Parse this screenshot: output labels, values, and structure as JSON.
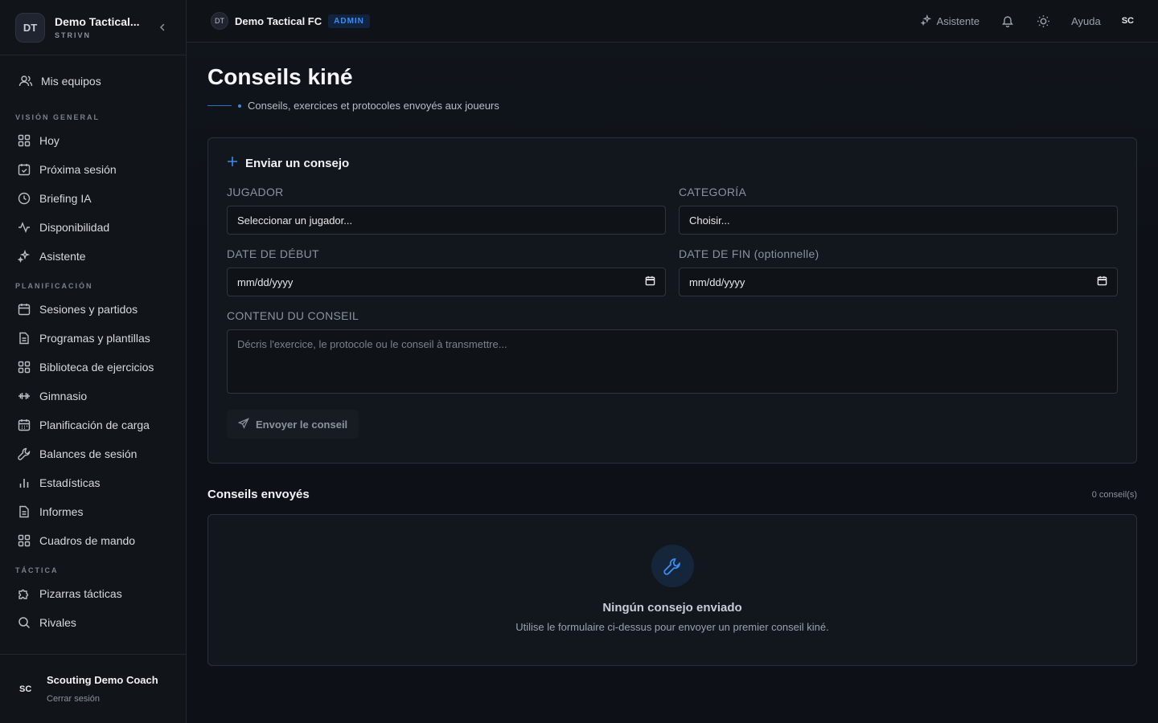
{
  "brand": {
    "initials": "DT",
    "name": "Demo Tactical...",
    "sub": "STRIVN"
  },
  "sidebar": {
    "top_item": "Mis equipos",
    "sections": [
      {
        "title": "VISIÓN GENERAL",
        "items": [
          "Hoy",
          "Próxima sesión",
          "Briefing IA",
          "Disponibilidad",
          "Asistente"
        ]
      },
      {
        "title": "PLANIFICACIÓN",
        "items": [
          "Sesiones y partidos",
          "Programas y plantillas",
          "Biblioteca de ejercicios",
          "Gimnasio",
          "Planificación de carga",
          "Balances de sesión",
          "Estadísticas",
          "Informes",
          "Cuadros de mando"
        ]
      },
      {
        "title": "TÁCTICA",
        "items": [
          "Pizarras tácticas",
          "Rivales"
        ]
      }
    ],
    "user": {
      "initials": "SC",
      "name": "Scouting Demo Coach",
      "logout": "Cerrar sesión"
    }
  },
  "topbar": {
    "club_initials": "DT",
    "club_name": "Demo Tactical FC",
    "badge": "ADMIN",
    "assistant": "Asistente",
    "help": "Ayuda",
    "user_initials": "SC"
  },
  "page": {
    "title": "Conseils kiné",
    "subtitle": "Conseils, exercices et protocoles envoyés aux joueurs"
  },
  "form": {
    "heading": "Enviar un consejo",
    "player_label": "JUGADOR",
    "player_value": "Seleccionar un jugador...",
    "category_label": "CATEGORÍA",
    "category_value": "Choisir...",
    "start_label": "DATE DE DÉBUT",
    "start_value": "mm/dd/yyyy",
    "end_label": "DATE DE FIN (optionnelle)",
    "end_value": "mm/dd/yyyy",
    "content_label": "CONTENU DU CONSEIL",
    "content_placeholder": "Décris l'exercice, le protocole ou le conseil à transmettre...",
    "send_label": "Envoyer le conseil"
  },
  "sent": {
    "title": "Conseils envoyés",
    "count": "0 conseil(s)",
    "empty_title": "Ningún consejo enviado",
    "empty_text": "Utilise le formulaire ci-dessus pour envoyer un premier conseil kiné."
  },
  "colors": {
    "accent": "#3b8cf0",
    "background": "#0d1117",
    "card": "#12171d"
  }
}
